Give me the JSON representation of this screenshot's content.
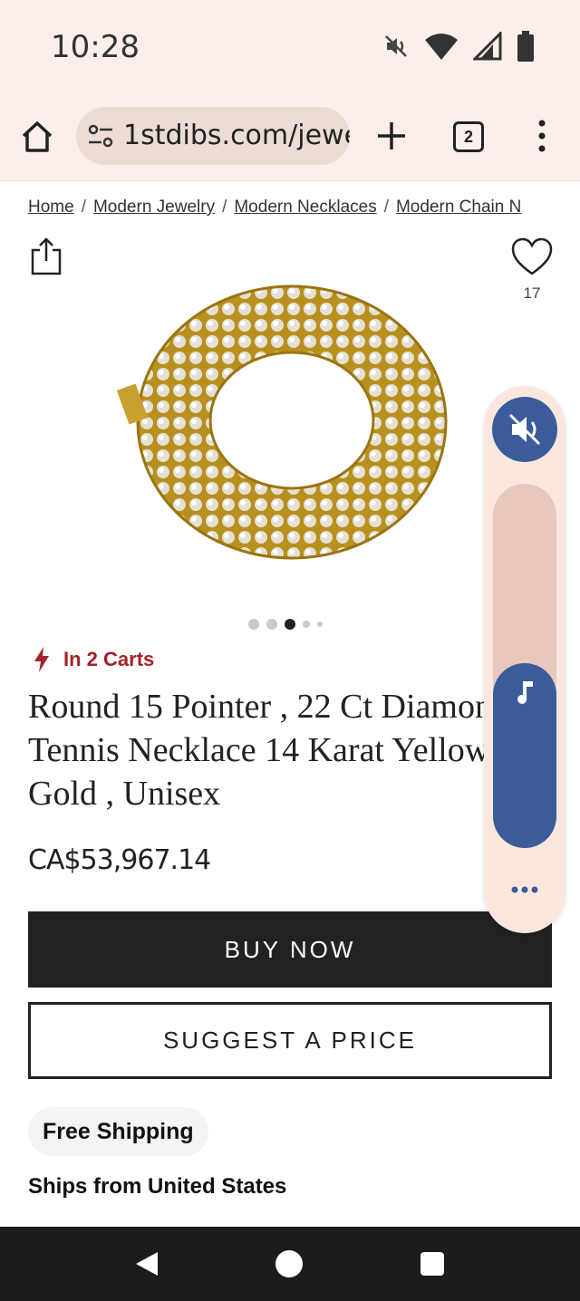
{
  "status_bar": {
    "time": "10:28",
    "icons": [
      "mute-icon",
      "wifi-icon",
      "signal-icon",
      "battery-icon"
    ]
  },
  "browser": {
    "url": "1stdibs.com/jewe",
    "tab_count": "2",
    "icons": [
      "home-icon",
      "site-settings-icon",
      "new-tab-icon",
      "tabs-icon",
      "menu-icon"
    ]
  },
  "breadcrumb": {
    "items": [
      "Home",
      "Modern Jewelry",
      "Modern Necklaces",
      "Modern Chain N"
    ],
    "separator": "/"
  },
  "favorite": {
    "count": "17"
  },
  "carousel": {
    "total": 5,
    "active": 3
  },
  "product": {
    "cart_status": "In 2 Carts",
    "title_lines": [
      "Round 15 Pointer , 22 Ct Diamon",
      "Tennis Necklace 14 Karat Yellow",
      "Gold , Unisex"
    ],
    "price": "CA$53,967.14"
  },
  "actions": {
    "buy_now": "BUY NOW",
    "suggest_price": "SUGGEST A PRICE"
  },
  "shipping": {
    "badge": "Free Shipping",
    "origin": "Ships from United States"
  },
  "volume_overlay": {
    "muted": true,
    "media_level": 0.5
  },
  "colors": {
    "accent_red": "#a3232a",
    "volume_blue": "#3b5b9a",
    "chrome_bg": "#fcefe9",
    "button_dark": "#222222"
  }
}
